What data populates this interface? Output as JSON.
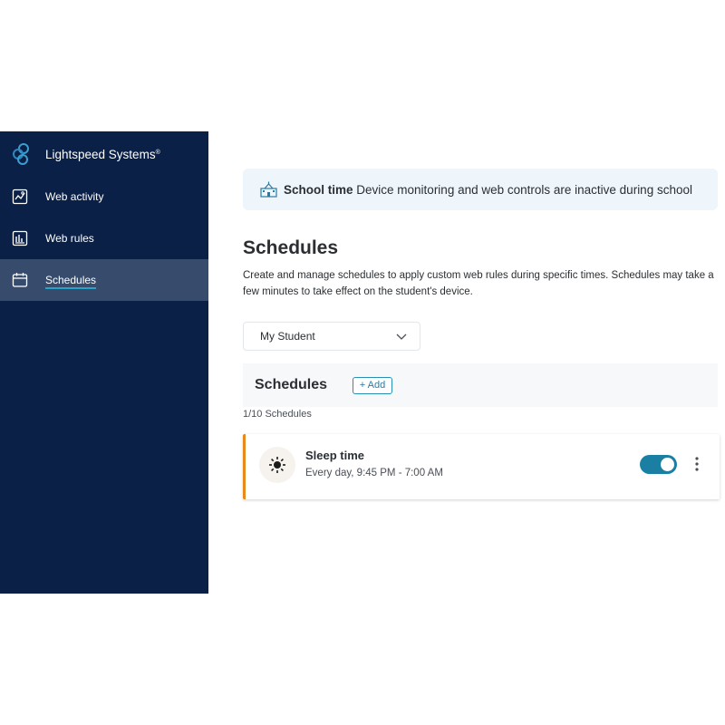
{
  "sidebar": {
    "brand": "Lightspeed Systems",
    "brand_mark": "®",
    "items": [
      {
        "label": "Web activity",
        "icon": "web-activity-icon"
      },
      {
        "label": "Web rules",
        "icon": "web-rules-icon"
      },
      {
        "label": "Schedules",
        "icon": "calendar-icon",
        "active": true
      }
    ]
  },
  "banner": {
    "icon": "school-icon",
    "title": "School time",
    "text": "Device monitoring and web controls are inactive during school"
  },
  "page": {
    "title": "Schedules",
    "description": "Create and manage schedules to apply custom web rules during specific times. Schedules may take a few minutes to take effect on the student's device."
  },
  "student_select": {
    "value": "My Student"
  },
  "schedules_panel": {
    "title": "Schedules",
    "add_label": "+ Add",
    "count": "1/10 Schedules"
  },
  "schedules": [
    {
      "title": "Sleep time",
      "subtitle": "Every day, 9:45 PM - 7:00 AM",
      "icon": "sun-icon",
      "enabled": true
    }
  ],
  "colors": {
    "sidebar_bg": "#0b2046",
    "sidebar_active": "#374c6c",
    "accent": "#1b7fa4",
    "card_border": "#e8891c",
    "banner_bg": "#eef5fb"
  }
}
